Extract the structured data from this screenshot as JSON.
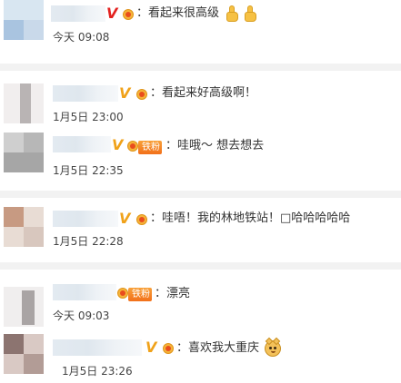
{
  "colors": {
    "separator": "#f2f2f2",
    "vip_orange": "#f0a21a",
    "vip_red": "#e3211f",
    "fan_badge": "#f2701a",
    "text": "#333333",
    "time": "#444444"
  },
  "comments": [
    {
      "text": "：看起来很高级",
      "time": "今天 09:08",
      "vip_badge": "V",
      "emoji": [
        "thumbs-up-icon",
        "thumbs-up-icon"
      ]
    },
    {
      "text": "：看起来好高级啊！",
      "time": "1月5日 23:00",
      "vip_badge": "V"
    },
    {
      "text": "：哇哦～ 想去想去",
      "time": "1月5日 22:35",
      "vip_badge": "V",
      "fan_badge": "铁粉"
    },
    {
      "text": "：哇唔！我的林地铁站！□哈哈哈哈哈",
      "time": "1月5日 22:28",
      "vip_badge": "V"
    },
    {
      "text": "：漂亮",
      "time": "今天 09:03",
      "fan_badge": "铁粉"
    },
    {
      "text": "：喜欢我大重庆",
      "time": "1月5日 23:26",
      "vip_badge": "V",
      "emoji": [
        "doge-icon"
      ]
    }
  ]
}
